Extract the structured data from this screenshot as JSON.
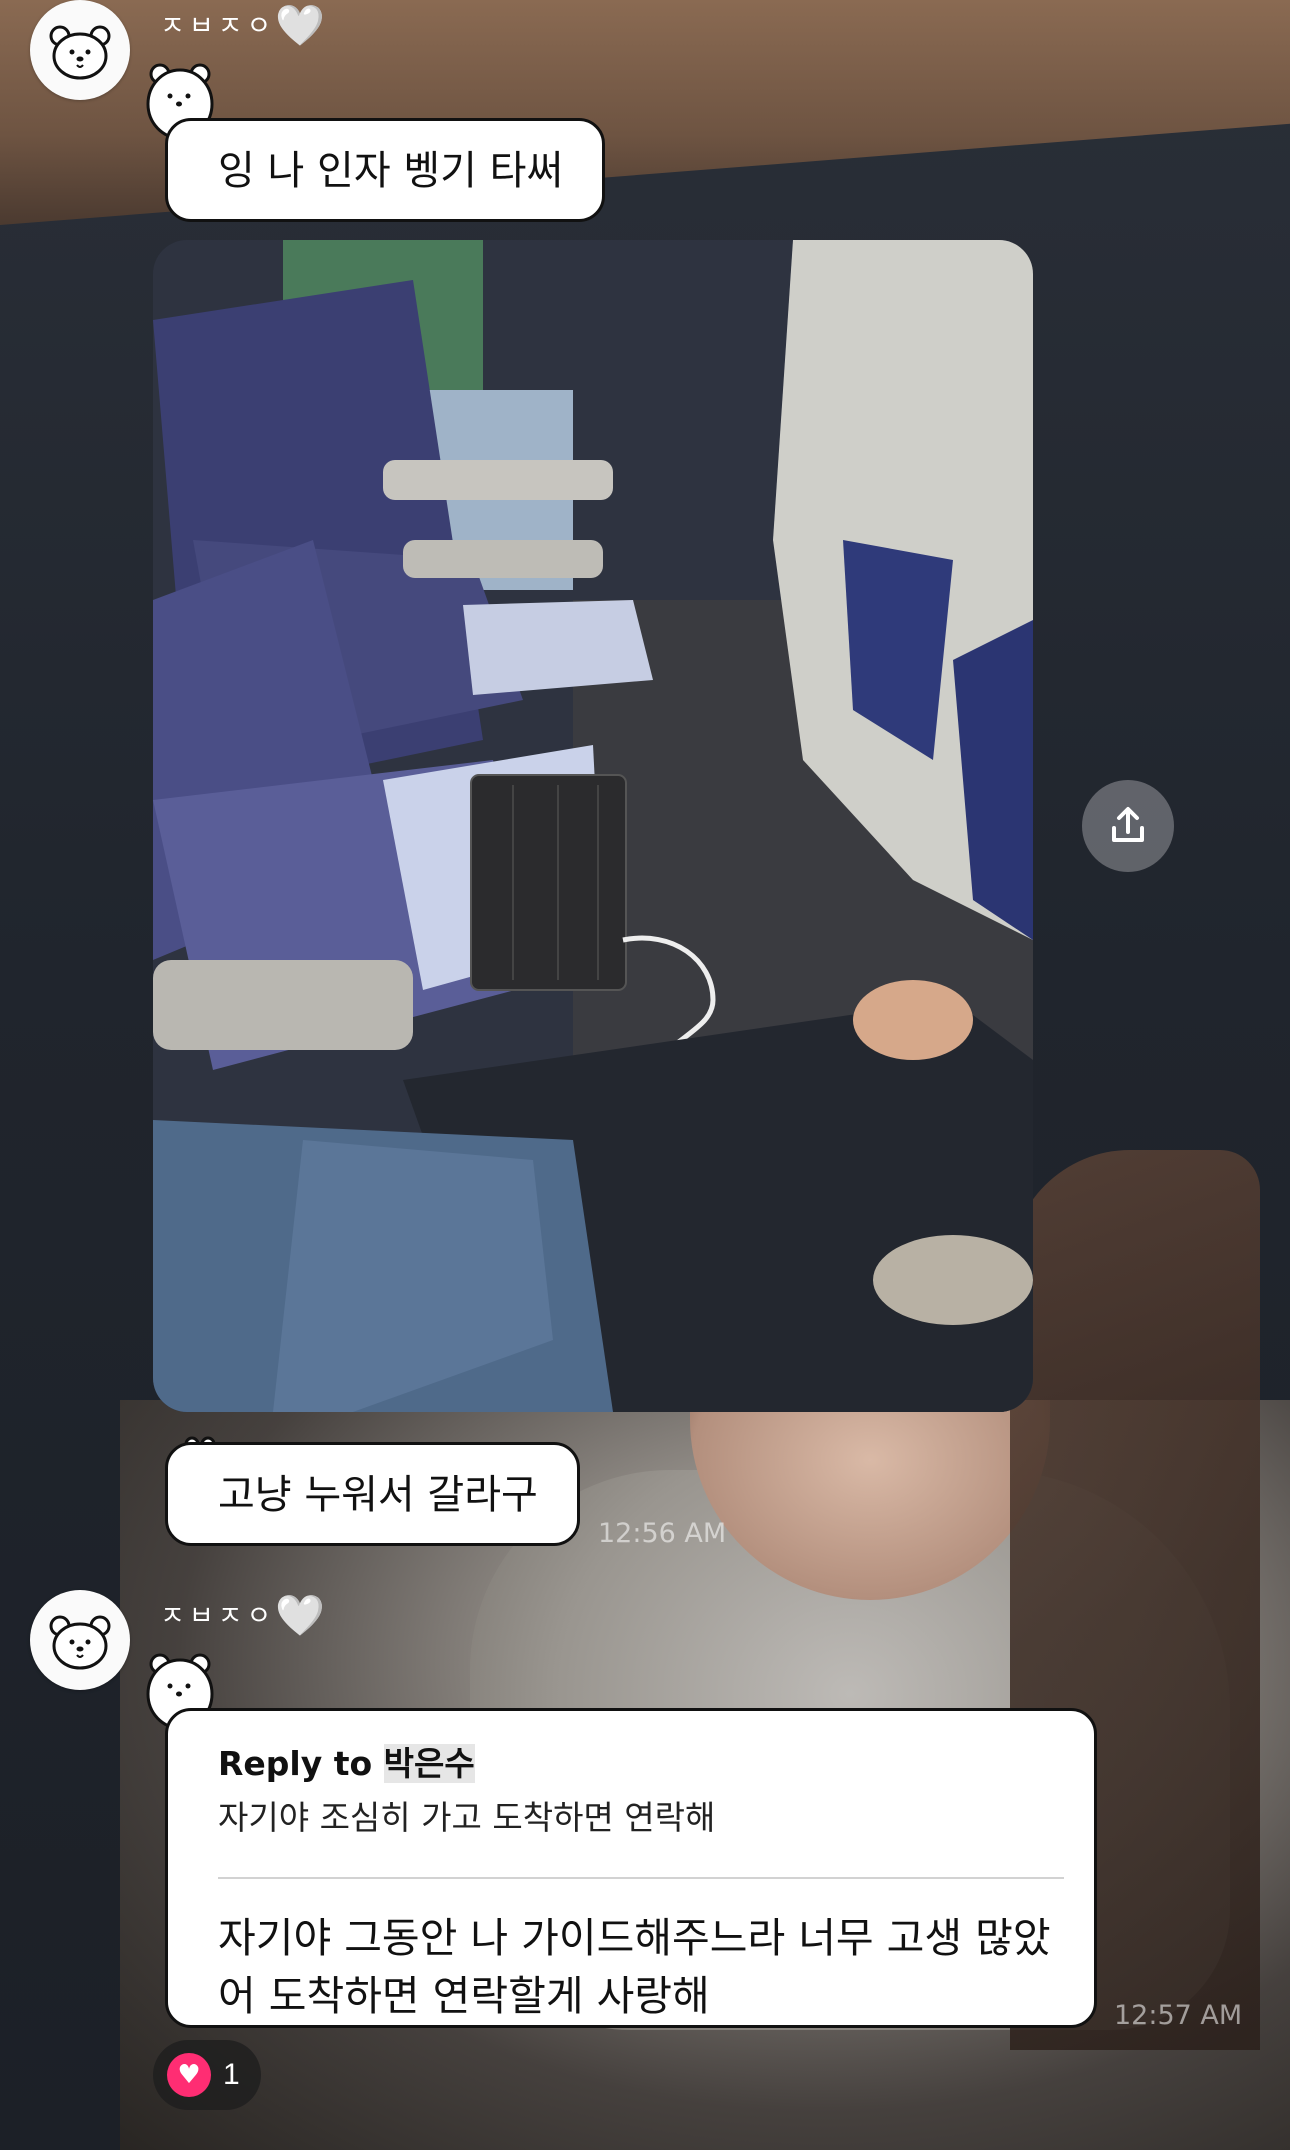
{
  "messages": [
    {
      "sender": "ㅈㅂㅈㅇ",
      "sender_heart": "🤍",
      "text": "잉 나 인자 벵기 타써"
    },
    {
      "image_alt": "airplane-seat-photo",
      "text": "고냥 누워서 갈라구",
      "time": "12:56 AM"
    },
    {
      "sender": "ㅈㅂㅈㅇ",
      "sender_heart": "🤍",
      "reply_label": "Reply to",
      "reply_name": "박은수",
      "reply_quote": "자기야 조심히 가고 도착하면 연락해",
      "text_line1": "자기야 그동안 나 가이드해주느라 너무 고생 많았",
      "text_line2": "어 도착하면 연락할게 사랑해",
      "time": "12:57 AM",
      "reaction_count": "1"
    }
  ],
  "icons": {
    "share": "share-icon",
    "reaction": "heart-icon",
    "avatar": "bear-avatar-icon"
  },
  "colors": {
    "reaction_heart": "#ff2d73",
    "bubble_bg": "#ffffff",
    "bubble_border": "#111111"
  }
}
